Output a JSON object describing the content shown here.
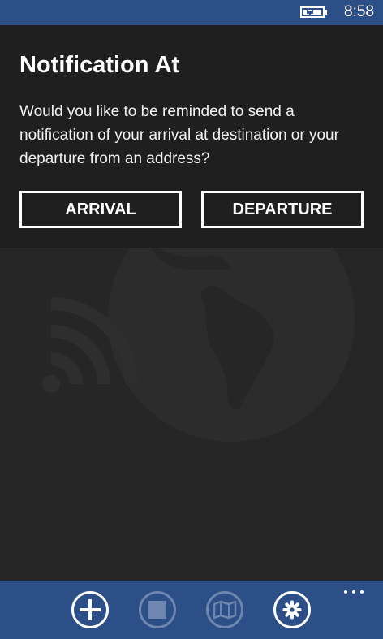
{
  "status_bar": {
    "time": "8:58",
    "battery_icon": "battery-charging-icon"
  },
  "dialog": {
    "title": "Notification At",
    "message": "Would you like to be reminded to send a notification of your arrival at destination or your departure from an address?",
    "buttons": {
      "arrival": "ARRIVAL",
      "departure": "DEPARTURE"
    }
  },
  "app_bar": {
    "buttons": [
      {
        "icon": "add-icon",
        "enabled": true
      },
      {
        "icon": "stop-icon",
        "enabled": false
      },
      {
        "icon": "map-icon",
        "enabled": false
      },
      {
        "icon": "settings-icon",
        "enabled": true
      }
    ],
    "more_icon": "more-dots-icon"
  },
  "colors": {
    "accent": "#2c4f87",
    "background": "#262626",
    "dialog_background": "#1f1f1f",
    "disabled": "#6d87b0",
    "text": "#ffffff"
  }
}
